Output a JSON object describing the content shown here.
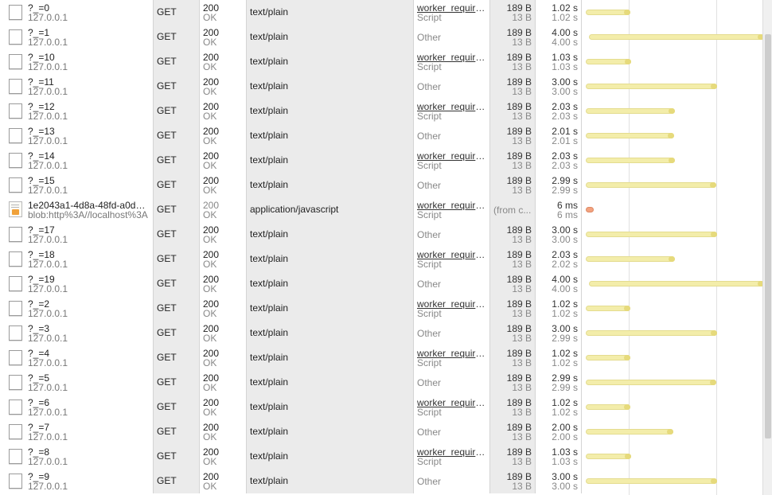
{
  "requests": [
    {
      "name": "?_=0",
      "domain": "127.0.0.1",
      "method": "GET",
      "status": "200",
      "status_text": "OK",
      "type": "text/plain",
      "initiator": "worker_require...",
      "initiator_type": "Script",
      "size": "189 B",
      "content": "13 B",
      "time": "1.02 s",
      "latency": "1.02 s",
      "icon": "file-icon",
      "duration": 1.02
    },
    {
      "name": "?_=1",
      "domain": "127.0.0.1",
      "method": "GET",
      "status": "200",
      "status_text": "OK",
      "type": "text/plain",
      "initiator": "Other",
      "initiator_type": "",
      "size": "189 B",
      "content": "13 B",
      "time": "4.00 s",
      "latency": "4.00 s",
      "icon": "file-icon",
      "duration": 4.0
    },
    {
      "name": "?_=10",
      "domain": "127.0.0.1",
      "method": "GET",
      "status": "200",
      "status_text": "OK",
      "type": "text/plain",
      "initiator": "worker_require...",
      "initiator_type": "Script",
      "size": "189 B",
      "content": "13 B",
      "time": "1.03 s",
      "latency": "1.03 s",
      "icon": "file-icon",
      "duration": 1.03
    },
    {
      "name": "?_=11",
      "domain": "127.0.0.1",
      "method": "GET",
      "status": "200",
      "status_text": "OK",
      "type": "text/plain",
      "initiator": "Other",
      "initiator_type": "",
      "size": "189 B",
      "content": "13 B",
      "time": "3.00 s",
      "latency": "3.00 s",
      "icon": "file-icon",
      "duration": 3.0
    },
    {
      "name": "?_=12",
      "domain": "127.0.0.1",
      "method": "GET",
      "status": "200",
      "status_text": "OK",
      "type": "text/plain",
      "initiator": "worker_require...",
      "initiator_type": "Script",
      "size": "189 B",
      "content": "13 B",
      "time": "2.03 s",
      "latency": "2.03 s",
      "icon": "file-icon",
      "duration": 2.03
    },
    {
      "name": "?_=13",
      "domain": "127.0.0.1",
      "method": "GET",
      "status": "200",
      "status_text": "OK",
      "type": "text/plain",
      "initiator": "Other",
      "initiator_type": "",
      "size": "189 B",
      "content": "13 B",
      "time": "2.01 s",
      "latency": "2.01 s",
      "icon": "file-icon",
      "duration": 2.01
    },
    {
      "name": "?_=14",
      "domain": "127.0.0.1",
      "method": "GET",
      "status": "200",
      "status_text": "OK",
      "type": "text/plain",
      "initiator": "worker_require...",
      "initiator_type": "Script",
      "size": "189 B",
      "content": "13 B",
      "time": "2.03 s",
      "latency": "2.03 s",
      "icon": "file-icon",
      "duration": 2.03
    },
    {
      "name": "?_=15",
      "domain": "127.0.0.1",
      "method": "GET",
      "status": "200",
      "status_text": "OK",
      "type": "text/plain",
      "initiator": "Other",
      "initiator_type": "",
      "size": "189 B",
      "content": "13 B",
      "time": "2.99 s",
      "latency": "2.99 s",
      "icon": "file-icon",
      "duration": 2.99
    },
    {
      "name": "1e2043a1-4d8a-48fd-a0de-...",
      "domain": "blob:http%3A//localhost%3A",
      "method": "GET",
      "status": "200",
      "status_text": "OK",
      "type": "application/javascript",
      "initiator": "worker_require...",
      "initiator_type": "Script",
      "size": "(from c...",
      "content": "",
      "time": "6 ms",
      "latency": "6 ms",
      "icon": "js-file-icon",
      "duration": 0.006,
      "cached": true
    },
    {
      "name": "?_=17",
      "domain": "127.0.0.1",
      "method": "GET",
      "status": "200",
      "status_text": "OK",
      "type": "text/plain",
      "initiator": "Other",
      "initiator_type": "",
      "size": "189 B",
      "content": "13 B",
      "time": "3.00 s",
      "latency": "3.00 s",
      "icon": "file-icon",
      "duration": 3.0
    },
    {
      "name": "?_=18",
      "domain": "127.0.0.1",
      "method": "GET",
      "status": "200",
      "status_text": "OK",
      "type": "text/plain",
      "initiator": "worker_require...",
      "initiator_type": "Script",
      "size": "189 B",
      "content": "13 B",
      "time": "2.03 s",
      "latency": "2.02 s",
      "icon": "file-icon",
      "duration": 2.03
    },
    {
      "name": "?_=19",
      "domain": "127.0.0.1",
      "method": "GET",
      "status": "200",
      "status_text": "OK",
      "type": "text/plain",
      "initiator": "Other",
      "initiator_type": "",
      "size": "189 B",
      "content": "13 B",
      "time": "4.00 s",
      "latency": "4.00 s",
      "icon": "file-icon",
      "duration": 4.0
    },
    {
      "name": "?_=2",
      "domain": "127.0.0.1",
      "method": "GET",
      "status": "200",
      "status_text": "OK",
      "type": "text/plain",
      "initiator": "worker_require...",
      "initiator_type": "Script",
      "size": "189 B",
      "content": "13 B",
      "time": "1.02 s",
      "latency": "1.02 s",
      "icon": "file-icon",
      "duration": 1.02
    },
    {
      "name": "?_=3",
      "domain": "127.0.0.1",
      "method": "GET",
      "status": "200",
      "status_text": "OK",
      "type": "text/plain",
      "initiator": "Other",
      "initiator_type": "",
      "size": "189 B",
      "content": "13 B",
      "time": "3.00 s",
      "latency": "2.99 s",
      "icon": "file-icon",
      "duration": 3.0
    },
    {
      "name": "?_=4",
      "domain": "127.0.0.1",
      "method": "GET",
      "status": "200",
      "status_text": "OK",
      "type": "text/plain",
      "initiator": "worker_require...",
      "initiator_type": "Script",
      "size": "189 B",
      "content": "13 B",
      "time": "1.02 s",
      "latency": "1.02 s",
      "icon": "file-icon",
      "duration": 1.02
    },
    {
      "name": "?_=5",
      "domain": "127.0.0.1",
      "method": "GET",
      "status": "200",
      "status_text": "OK",
      "type": "text/plain",
      "initiator": "Other",
      "initiator_type": "",
      "size": "189 B",
      "content": "13 B",
      "time": "2.99 s",
      "latency": "2.99 s",
      "icon": "file-icon",
      "duration": 2.99
    },
    {
      "name": "?_=6",
      "domain": "127.0.0.1",
      "method": "GET",
      "status": "200",
      "status_text": "OK",
      "type": "text/plain",
      "initiator": "worker_require...",
      "initiator_type": "Script",
      "size": "189 B",
      "content": "13 B",
      "time": "1.02 s",
      "latency": "1.02 s",
      "icon": "file-icon",
      "duration": 1.02
    },
    {
      "name": "?_=7",
      "domain": "127.0.0.1",
      "method": "GET",
      "status": "200",
      "status_text": "OK",
      "type": "text/plain",
      "initiator": "Other",
      "initiator_type": "",
      "size": "189 B",
      "content": "13 B",
      "time": "2.00 s",
      "latency": "2.00 s",
      "icon": "file-icon",
      "duration": 2.0
    },
    {
      "name": "?_=8",
      "domain": "127.0.0.1",
      "method": "GET",
      "status": "200",
      "status_text": "OK",
      "type": "text/plain",
      "initiator": "worker_require...",
      "initiator_type": "Script",
      "size": "189 B",
      "content": "13 B",
      "time": "1.03 s",
      "latency": "1.03 s",
      "icon": "file-icon",
      "duration": 1.03
    },
    {
      "name": "?_=9",
      "domain": "127.0.0.1",
      "method": "GET",
      "status": "200",
      "status_text": "OK",
      "type": "text/plain",
      "initiator": "Other",
      "initiator_type": "",
      "size": "189 B",
      "content": "13 B",
      "time": "3.00 s",
      "latency": "3.00 s",
      "icon": "file-icon",
      "duration": 3.0
    }
  ],
  "colors": {
    "bar_fill": "#f3edaa",
    "bar_cap": "#e6da7c",
    "cached_dot": "#f3a27f",
    "shaded_column": "#ebebeb"
  }
}
